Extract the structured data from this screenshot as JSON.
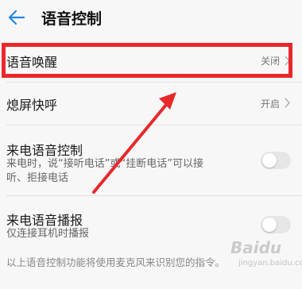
{
  "header": {
    "title": "语音控制",
    "back_icon": "back-arrow-icon"
  },
  "settings": {
    "wake": {
      "label": "语音唤醒",
      "value": "关闭"
    },
    "screen_off_quick": {
      "label": "熄屏快呼",
      "value": "开启"
    },
    "incoming_call_control": {
      "label": "来电语音控制",
      "description_line1": "来电时，说“接听电话”或“挂断电话”可以接",
      "description_line2": "听、拒接电话"
    },
    "incoming_call_announce": {
      "label": "来电语音播报",
      "description": "仅连接耳机时播报"
    }
  },
  "footer": {
    "text": "以上语音控制功能将使用麦克风来识别您的指令。"
  },
  "watermark": {
    "brand": "Baidu",
    "sub": "jingyan.baidu.com"
  },
  "colors": {
    "highlight": "#e8282b",
    "arrow": "#e8282b",
    "accent": "#1e88e5"
  }
}
